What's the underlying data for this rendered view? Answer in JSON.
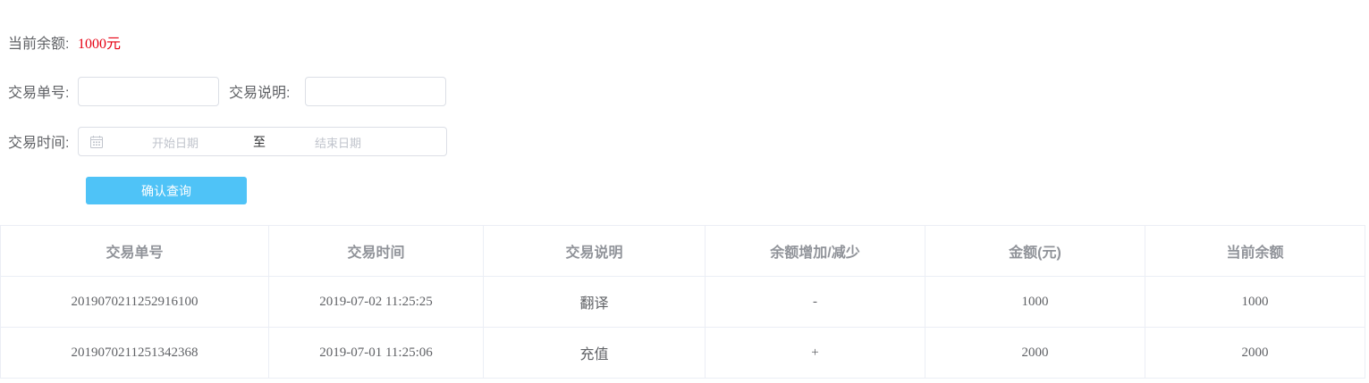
{
  "balance": {
    "label": "当前余额:",
    "value": "1000元"
  },
  "filters": {
    "order_no_label": "交易单号:",
    "order_no_value": "",
    "desc_label": "交易说明:",
    "desc_value": "",
    "time_label": "交易时间:",
    "start_placeholder": "开始日期",
    "range_separator": "至",
    "end_placeholder": "结束日期",
    "calendar_icon": "calendar-icon"
  },
  "actions": {
    "query_label": "确认查询"
  },
  "colors": {
    "accent": "#4fc3f7",
    "balance_value": "#e60012",
    "border": "#dcdfe6",
    "header_text": "#909399"
  },
  "table": {
    "columns": [
      "交易单号",
      "交易时间",
      "交易说明",
      "余额增加/减少",
      "金额(元)",
      "当前余额"
    ],
    "rows": [
      [
        "2019070211252916100",
        "2019-07-02 11:25:25",
        "翻译",
        "-",
        "1000",
        "1000"
      ],
      [
        "2019070211251342368",
        "2019-07-01 11:25:06",
        "充值",
        "+",
        "2000",
        "2000"
      ]
    ]
  }
}
